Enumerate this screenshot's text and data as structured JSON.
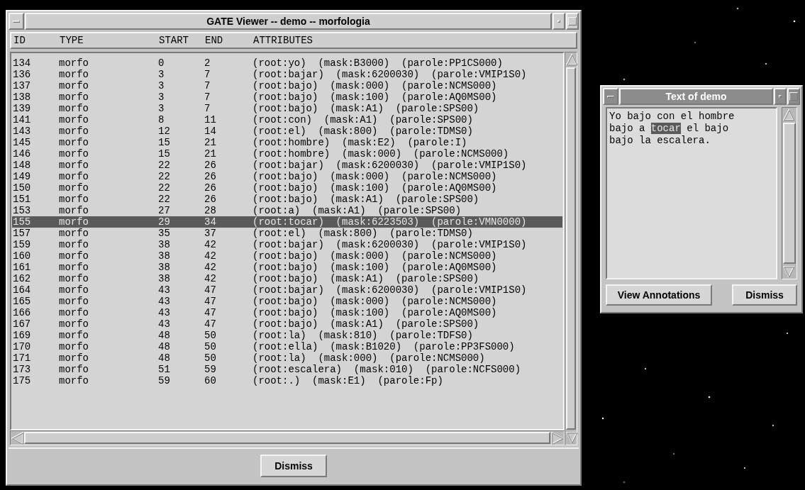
{
  "main_window": {
    "title": "GATE Viewer -- demo -- morfologia",
    "columns": [
      "ID",
      "TYPE",
      "START",
      "END",
      "ATTRIBUTES"
    ],
    "rows": [
      {
        "cells": [
          "134",
          "morfo",
          "0",
          "2",
          "(root:yo)  (mask:B3000)  (parole:PP1CS000)"
        ],
        "selected": false
      },
      {
        "cells": [
          "136",
          "morfo",
          "3",
          "7",
          "(root:bajar)  (mask:6200030)  (parole:VMIP1S0)"
        ],
        "selected": false
      },
      {
        "cells": [
          "137",
          "morfo",
          "3",
          "7",
          "(root:bajo)  (mask:000)  (parole:NCMS000)"
        ],
        "selected": false
      },
      {
        "cells": [
          "138",
          "morfo",
          "3",
          "7",
          "(root:bajo)  (mask:100)  (parole:AQ0MS00)"
        ],
        "selected": false
      },
      {
        "cells": [
          "139",
          "morfo",
          "3",
          "7",
          "(root:bajo)  (mask:A1)  (parole:SPS00)"
        ],
        "selected": false
      },
      {
        "cells": [
          "141",
          "morfo",
          "8",
          "11",
          "(root:con)  (mask:A1)  (parole:SPS00)"
        ],
        "selected": false
      },
      {
        "cells": [
          "143",
          "morfo",
          "12",
          "14",
          "(root:el)  (mask:800)  (parole:TDMS0)"
        ],
        "selected": false
      },
      {
        "cells": [
          "145",
          "morfo",
          "15",
          "21",
          "(root:hombre)  (mask:E2)  (parole:I)"
        ],
        "selected": false
      },
      {
        "cells": [
          "146",
          "morfo",
          "15",
          "21",
          "(root:hombre)  (mask:000)  (parole:NCMS000)"
        ],
        "selected": false
      },
      {
        "cells": [
          "148",
          "morfo",
          "22",
          "26",
          "(root:bajar)  (mask:6200030)  (parole:VMIP1S0)"
        ],
        "selected": false
      },
      {
        "cells": [
          "149",
          "morfo",
          "22",
          "26",
          "(root:bajo)  (mask:000)  (parole:NCMS000)"
        ],
        "selected": false
      },
      {
        "cells": [
          "150",
          "morfo",
          "22",
          "26",
          "(root:bajo)  (mask:100)  (parole:AQ0MS00)"
        ],
        "selected": false
      },
      {
        "cells": [
          "151",
          "morfo",
          "22",
          "26",
          "(root:bajo)  (mask:A1)  (parole:SPS00)"
        ],
        "selected": false
      },
      {
        "cells": [
          "153",
          "morfo",
          "27",
          "28",
          "(root:a)  (mask:A1)  (parole:SPS00)"
        ],
        "selected": false
      },
      {
        "cells": [
          "155",
          "morfo",
          "29",
          "34",
          "(root:tocar)  (mask:6223503)  (parole:VMN0000)"
        ],
        "selected": true
      },
      {
        "cells": [
          "157",
          "morfo",
          "35",
          "37",
          "(root:el)  (mask:800)  (parole:TDMS0)"
        ],
        "selected": false
      },
      {
        "cells": [
          "159",
          "morfo",
          "38",
          "42",
          "(root:bajar)  (mask:6200030)  (parole:VMIP1S0)"
        ],
        "selected": false
      },
      {
        "cells": [
          "160",
          "morfo",
          "38",
          "42",
          "(root:bajo)  (mask:000)  (parole:NCMS000)"
        ],
        "selected": false
      },
      {
        "cells": [
          "161",
          "morfo",
          "38",
          "42",
          "(root:bajo)  (mask:100)  (parole:AQ0MS00)"
        ],
        "selected": false
      },
      {
        "cells": [
          "162",
          "morfo",
          "38",
          "42",
          "(root:bajo)  (mask:A1)  (parole:SPS00)"
        ],
        "selected": false
      },
      {
        "cells": [
          "164",
          "morfo",
          "43",
          "47",
          "(root:bajar)  (mask:6200030)  (parole:VMIP1S0)"
        ],
        "selected": false
      },
      {
        "cells": [
          "165",
          "morfo",
          "43",
          "47",
          "(root:bajo)  (mask:000)  (parole:NCMS000)"
        ],
        "selected": false
      },
      {
        "cells": [
          "166",
          "morfo",
          "43",
          "47",
          "(root:bajo)  (mask:100)  (parole:AQ0MS00)"
        ],
        "selected": false
      },
      {
        "cells": [
          "167",
          "morfo",
          "43",
          "47",
          "(root:bajo)  (mask:A1)  (parole:SPS00)"
        ],
        "selected": false
      },
      {
        "cells": [
          "169",
          "morfo",
          "48",
          "50",
          "(root:la)  (mask:810)  (parole:TDFS0)"
        ],
        "selected": false
      },
      {
        "cells": [
          "170",
          "morfo",
          "48",
          "50",
          "(root:ella)  (mask:B1020)  (parole:PP3FS000)"
        ],
        "selected": false
      },
      {
        "cells": [
          "171",
          "morfo",
          "48",
          "50",
          "(root:la)  (mask:000)  (parole:NCMS000)"
        ],
        "selected": false
      },
      {
        "cells": [
          "173",
          "morfo",
          "51",
          "59",
          "(root:escalera)  (mask:010)  (parole:NCFS000)"
        ],
        "selected": false
      },
      {
        "cells": [
          "175",
          "morfo",
          "59",
          "60",
          "(root:.)  (mask:E1)  (parole:Fp)"
        ],
        "selected": false
      }
    ],
    "buttons": [
      "Dismiss"
    ]
  },
  "text_window": {
    "title": "Text of demo",
    "lines": [
      [
        {
          "text": "Yo bajo con el hombre",
          "highlighted": false
        }
      ],
      [
        {
          "text": "bajo a ",
          "highlighted": false
        },
        {
          "text": "tocar",
          "highlighted": true
        },
        {
          "text": " el bajo",
          "highlighted": false
        }
      ],
      [
        {
          "text": "bajo la escalera.",
          "highlighted": false
        }
      ]
    ],
    "buttons": [
      "View Annotations",
      "Dismiss"
    ]
  }
}
